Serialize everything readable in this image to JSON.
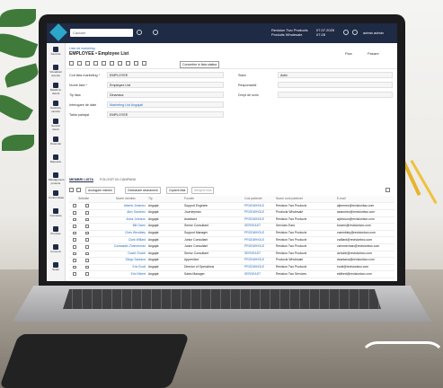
{
  "topbar": {
    "search_placeholder": "Cautare",
    "company_line1": "Revision Two Products",
    "company_line2": "Produits Wholesale",
    "date_line1": "07.07.2025",
    "date_line2": "07:28",
    "user": "admin admin"
  },
  "sidebar": {
    "items": [
      {
        "label": "Favorite"
      },
      {
        "label": "Vizualizari recente"
      },
      {
        "label": "Relatii cu clientii"
      },
      {
        "label": "Gestiune vanzari"
      },
      {
        "label": "Servicii clienti"
      },
      {
        "label": "Financiar"
      },
      {
        "label": "Rapoarte"
      },
      {
        "label": "Management proiecte"
      },
      {
        "label": "Conformitate"
      },
      {
        "label": "Cercetare"
      },
      {
        "label": "Produse"
      },
      {
        "label": "Comenzi"
      },
      {
        "label": "Setari"
      }
    ]
  },
  "header": {
    "breadcrumb": "Liste de marketing",
    "title": "EMPLOYEE • Employee List",
    "fisa_label": "Fisa",
    "pasare_label": "Pasare"
  },
  "toolbar": {
    "convert_label": "Convertire in lista statica"
  },
  "form": {
    "left": [
      {
        "label": "Cod lista marketing *",
        "value": "EMPLOYEE",
        "link": false
      },
      {
        "label": "Nume lista *",
        "value": "Employee List",
        "link": false
      },
      {
        "label": "Tip lista",
        "value": "Dinamica",
        "link": false
      },
      {
        "label": "Interogare de date",
        "value": "Marketing List Angajati",
        "link": true
      },
      {
        "label": "Tabla partajat",
        "value": "EMPLOYEE",
        "link": false
      }
    ],
    "right": [
      {
        "label": "Stare",
        "value": "Activ"
      },
      {
        "label": "Responsabil",
        "value": ""
      },
      {
        "label": "Drept de scris",
        "value": ""
      }
    ]
  },
  "tabs": [
    {
      "label": "MEMBRI LISTA",
      "active": true
    },
    {
      "label": "FOLOSIT IN CAMPANII",
      "active": false
    }
  ],
  "gridbar": {
    "chips": [
      "Anulugare membri",
      "Gestionare abonament",
      "Copiere lista",
      "Stergere lista"
    ]
  },
  "table": {
    "headers": [
      "Selectie",
      "Nume membru",
      "Tip",
      "Functie",
      "Cod partener",
      "Nume cont partener",
      "E-mail"
    ],
    "rows": [
      {
        "name": "Alberto Jimenez",
        "tip": "Angajat",
        "functie": "Support Engineer",
        "cod": "PRODWHOLE",
        "cont": "Revision Two Products",
        "email": "ajimenez@revisiontwo.com"
      },
      {
        "name": "Alex Sanchez",
        "tip": "Angajat",
        "functie": "Journeyman",
        "cod": "PRODWHOLE",
        "cont": "Products Wholesale",
        "email": "asanchez@revisiontwo.com"
      },
      {
        "name": "Anna Johnson",
        "tip": "Angajat",
        "functie": "Assistant",
        "cod": "PRODWHOLE",
        "cont": "Revision Two Products",
        "email": "ajohnson@revisiontwo.com"
      },
      {
        "name": "Bill Owen",
        "tip": "Angajat",
        "functie": "Senior Consultant",
        "cod": "SERVEAST",
        "cont": "Services East",
        "email": "bowen@revisiontwo.com"
      },
      {
        "name": "Chris Wembley",
        "tip": "Angajat",
        "functie": "Support Manager",
        "cod": "PRODWHOLE",
        "cont": "Revision Two Products",
        "email": "cwembley@revisiontwo.com"
      },
      {
        "name": "Clark Willard",
        "tip": "Angajat",
        "functie": "Junior Consultant",
        "cod": "PRODWHOLE",
        "cont": "Revision Two Products",
        "email": "cwillard@revisiontwo.com"
      },
      {
        "name": "Constantin Zimmerman",
        "tip": "Angajat",
        "functie": "Junior Consultant",
        "cod": "PRODWHOLE",
        "cont": "Revision Two Products",
        "email": "czimmerman@revisiontwo.com"
      },
      {
        "name": "David Chubb",
        "tip": "Angajat",
        "functie": "Senior Consultant",
        "cod": "SERVEAST",
        "cont": "Revision Two Products",
        "email": "dchubb@revisiontwo.com"
      },
      {
        "name": "Diego Santana",
        "tip": "Angajat",
        "functie": "Apprentice",
        "cod": "PRODWHOLE",
        "cont": "Products Wholesale",
        "email": "dsantana@revisiontwo.com"
      },
      {
        "name": "Eric Ecott",
        "tip": "Angajat",
        "functie": "Director of Operations",
        "cod": "PRODWHOLE",
        "cont": "Revision Two Products",
        "email": "ecott@revisiontwo.com"
      },
      {
        "name": "Eric Kilbert",
        "tip": "Angajat",
        "functie": "Sales Manager",
        "cod": "SERVEAST",
        "cont": "Revision Two Services",
        "email": "ekilbert@revisiontwo.com"
      }
    ]
  }
}
